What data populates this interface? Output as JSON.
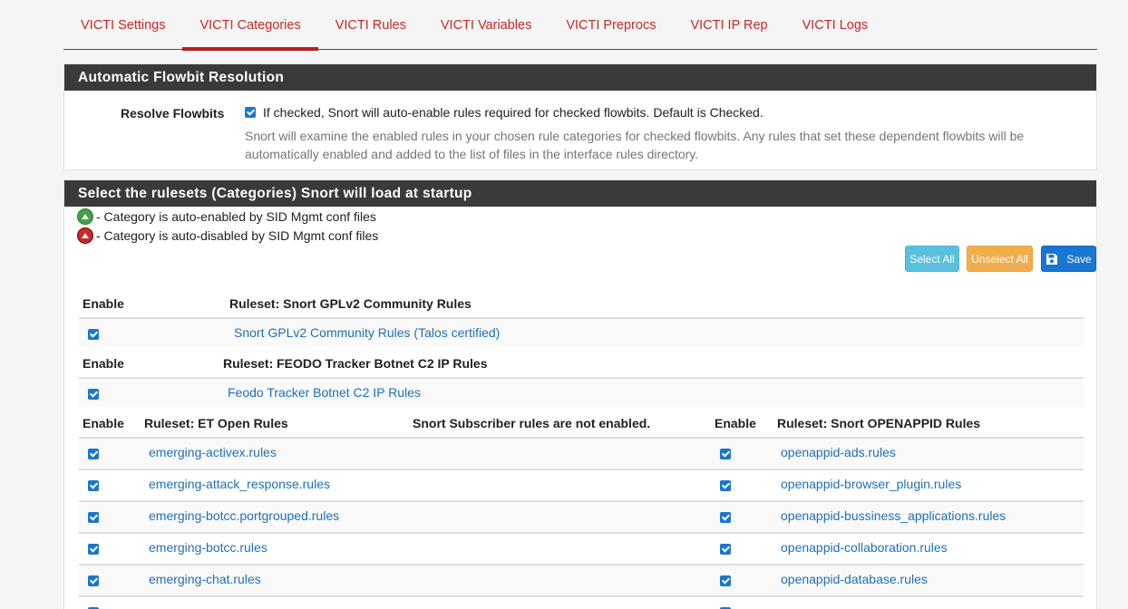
{
  "tabs": [
    {
      "label": "VICTI Settings",
      "active": false
    },
    {
      "label": "VICTI Categories",
      "active": true
    },
    {
      "label": "VICTI Rules",
      "active": false
    },
    {
      "label": "VICTI Variables",
      "active": false
    },
    {
      "label": "VICTI Preprocs",
      "active": false
    },
    {
      "label": "VICTI IP Rep",
      "active": false
    },
    {
      "label": "VICTI Logs",
      "active": false
    }
  ],
  "flowbit": {
    "heading": "Automatic Flowbit Resolution",
    "label": "Resolve Flowbits",
    "checked": true,
    "text": "If checked, Snort will auto-enable rules required for checked flowbits. Default is Checked.",
    "help": "Snort will examine the enabled rules in your chosen rule categories for checked flowbits. Any rules that set these dependent flowbits will be automatically enabled and added to the list of files in the interface rules directory."
  },
  "rulesets": {
    "heading": "Select the rulesets (Categories) Snort will load at startup",
    "legend_enabled": "- Category is auto-enabled by SID Mgmt conf files",
    "legend_disabled": "- Category is auto-disabled by SID Mgmt conf files",
    "select_all": "Select All",
    "unselect_all": "Unselect All",
    "save": "Save",
    "gplv2": {
      "enable_header": "Enable",
      "ruleset_header": "Ruleset: Snort GPLv2 Community Rules",
      "item": "Snort GPLv2 Community Rules (Talos certified)"
    },
    "feodo": {
      "enable_header": "Enable",
      "ruleset_header": "Ruleset: FEODO Tracker Botnet C2 IP Rules",
      "item": "Feodo Tracker Botnet C2 IP Rules"
    },
    "et_open": {
      "enable_header": "Enable",
      "ruleset_header": "Ruleset: ET Open Rules",
      "subscriber_note": "Snort Subscriber rules are not enabled.",
      "openappid_enable_header": "Enable",
      "openappid_header": "Ruleset: Snort OPENAPPID Rules",
      "rows": [
        {
          "et": "emerging-activex.rules",
          "openappid": "openappid-ads.rules"
        },
        {
          "et": "emerging-attack_response.rules",
          "openappid": "openappid-browser_plugin.rules"
        },
        {
          "et": "emerging-botcc.portgrouped.rules",
          "openappid": "openappid-bussiness_applications.rules"
        },
        {
          "et": "emerging-botcc.rules",
          "openappid": "openappid-collaboration.rules"
        },
        {
          "et": "emerging-chat.rules",
          "openappid": "openappid-database.rules"
        }
      ]
    }
  }
}
